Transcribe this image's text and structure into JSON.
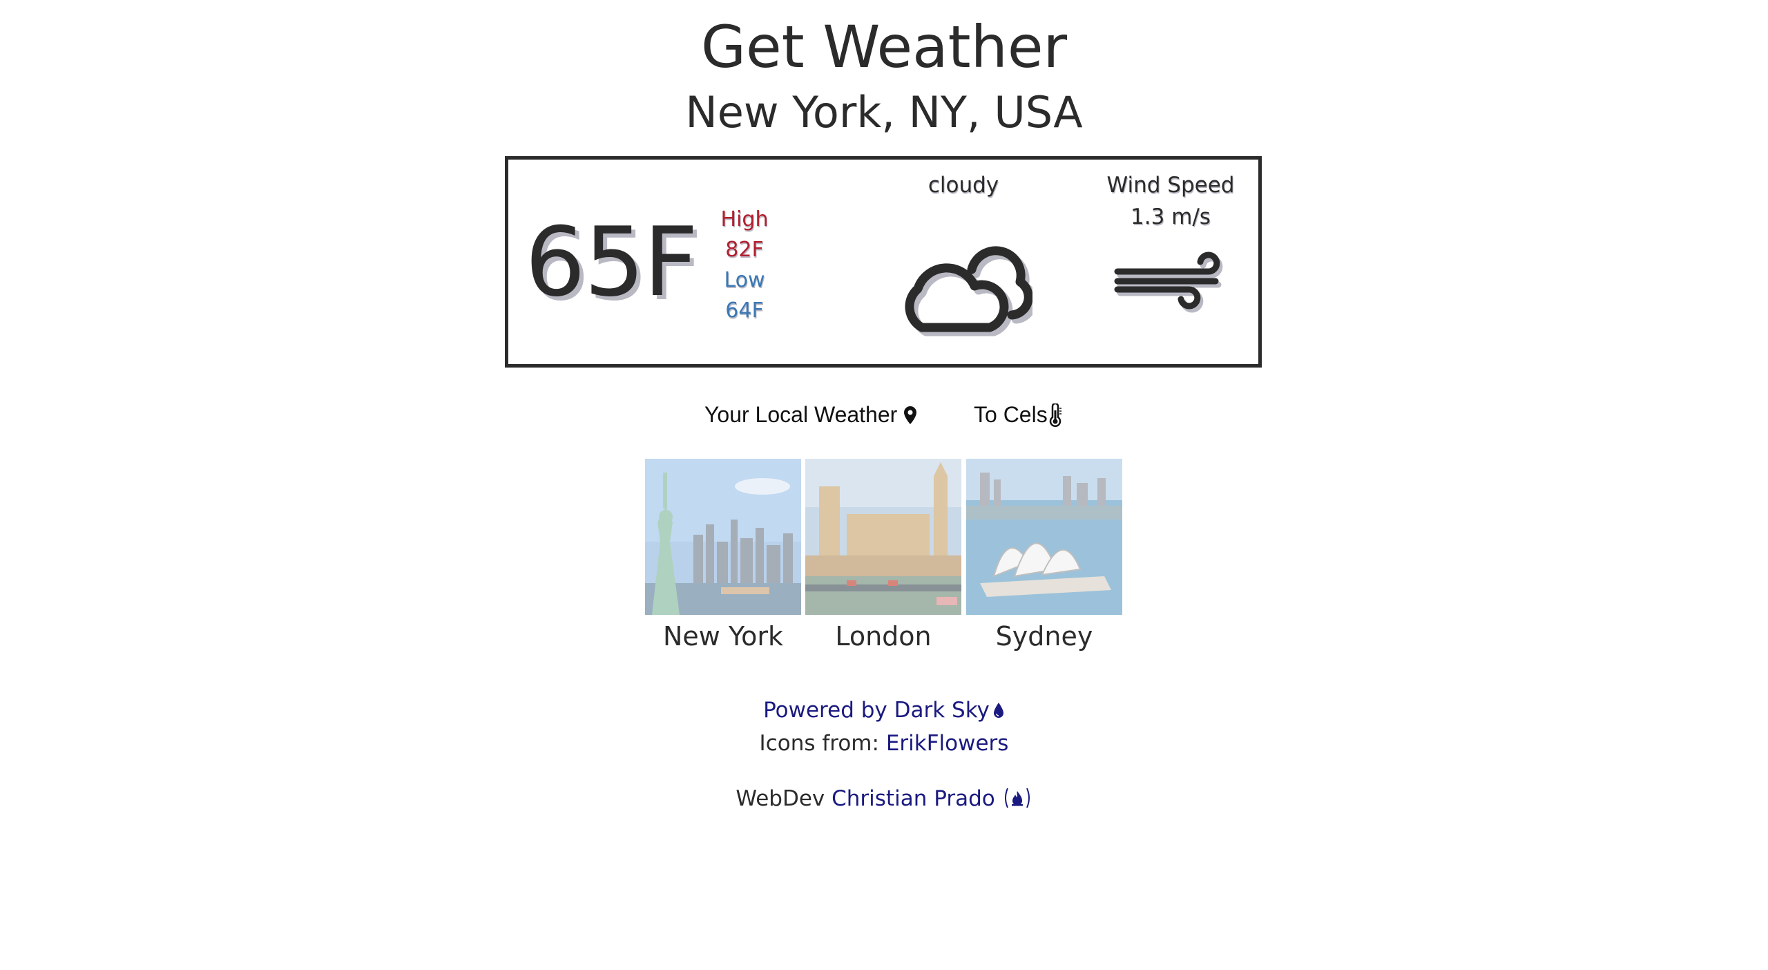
{
  "header": {
    "title": "Get Weather",
    "location": "New York, NY, USA"
  },
  "current": {
    "temperature": "65F",
    "high_label": "High",
    "high_value": "82F",
    "low_label": "Low",
    "low_value": "64F",
    "condition": "cloudy",
    "condition_icon": "cloudy-icon",
    "wind_label": "Wind Speed",
    "wind_value": "1.3 m/s",
    "wind_icon": "wind-icon"
  },
  "controls": {
    "local_weather_label": "Your Local Weather",
    "local_weather_icon": "map-pin-icon",
    "units_label": "To Cels",
    "units_icon": "thermometer-icon"
  },
  "cities": [
    {
      "name": "New York"
    },
    {
      "name": "London"
    },
    {
      "name": "Sydney"
    }
  ],
  "footer": {
    "powered_by": "Powered by Dark Sky",
    "powered_icon": "raindrop-icon",
    "icons_prefix": "Icons from:",
    "icons_link": "ErikFlowers",
    "webdev_prefix": "WebDev",
    "webdev_link": "Christian Prado",
    "webdev_icon": "flame-icon"
  },
  "colors": {
    "text": "#2b2b2b",
    "high": "#b22030",
    "low": "#3a78b5",
    "link": "#1a1a80",
    "shadow": "#b9b9c4"
  }
}
